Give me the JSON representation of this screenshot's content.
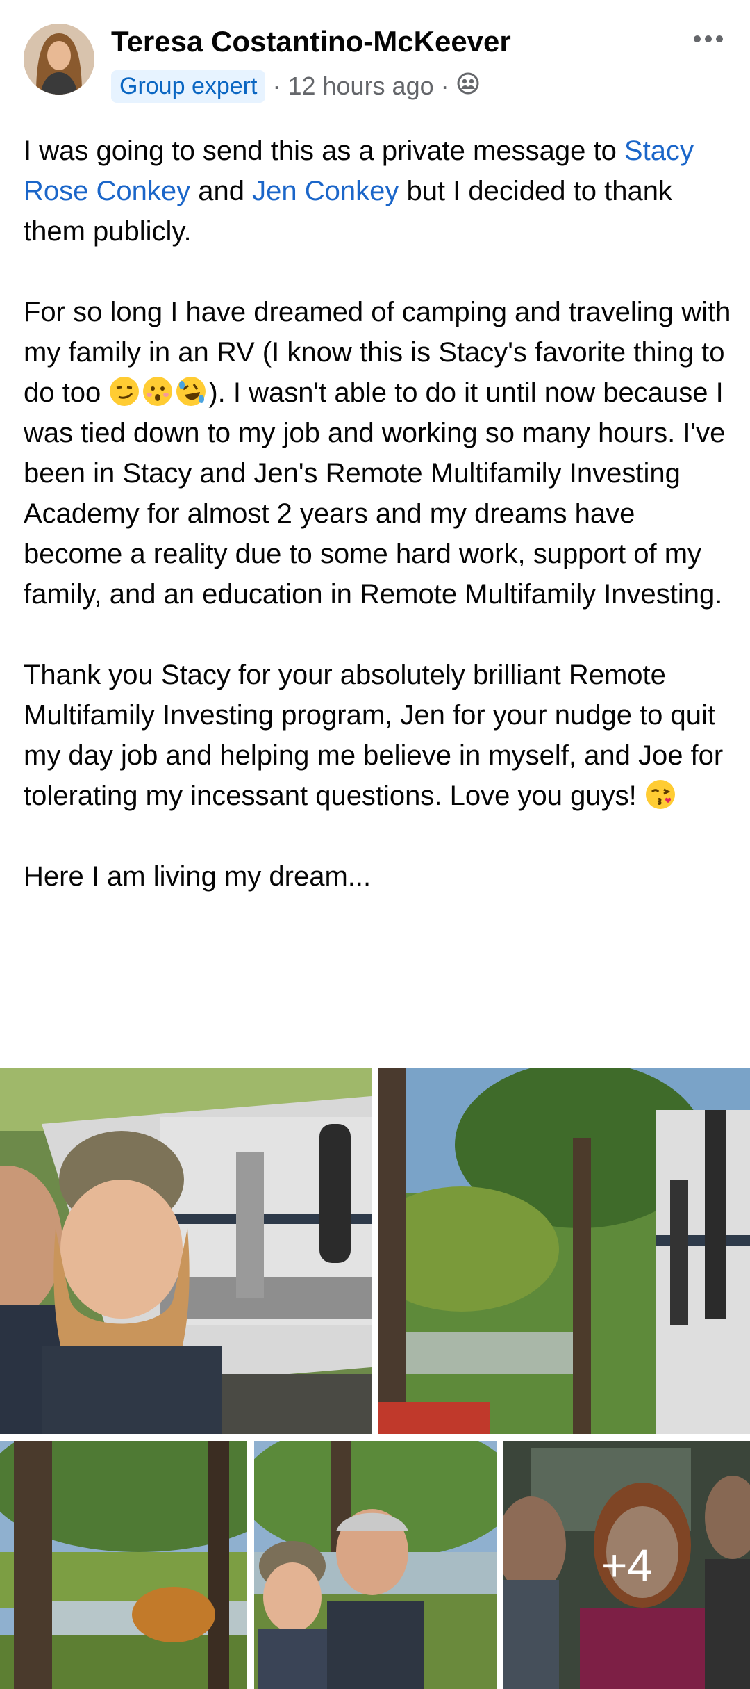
{
  "post": {
    "author": "Teresa Costantino-McKeever",
    "badge": "Group expert",
    "separator": "·",
    "time": "12 hours ago",
    "audience_icon": "group-members-icon",
    "menu_icon": "more-options-icon"
  },
  "body": {
    "p1_a": "I was going to send this as a private message to ",
    "mention_1": "Stacy Rose Conkey",
    "p1_b": " and ",
    "mention_2": "Jen Conkey",
    "p1_c": "  but I decided to thank them publicly.",
    "p2_a": "For so long I have dreamed of camping and traveling with my family in an RV (I know this is Stacy's favorite thing to do too ",
    "p2_emojis": [
      "smirk-emoji",
      "astonished-emoji",
      "rolling-laughing-emoji"
    ],
    "p2_b": "). I wasn't able to do it until now because I was tied down to my job and working so many hours. I've been in Stacy and Jen's Remote Multifamily Investing Academy for almost 2 years and my dreams have become a reality due to some hard work, support of my family, and an education in Remote Multifamily Investing.",
    "p3_a": "Thank you Stacy for your absolutely brilliant Remote Multifamily Investing program, Jen for your nudge to quit my day job and helping me believe in myself, and Joe for tolerating my incessant questions. Love you guys! ",
    "p3_emoji": "kiss-emoji",
    "p4": "Here I am living my dream..."
  },
  "photos": {
    "more_count": "+4",
    "items": [
      "selfie-with-rv",
      "lake-view-with-rv",
      "forest-lake",
      "couple-by-lake",
      "family-in-rv"
    ]
  },
  "colors": {
    "mention": "#1b66c9",
    "badge_bg": "#e7f3ff",
    "badge_text": "#0a66c2",
    "meta_text": "#65676b"
  }
}
